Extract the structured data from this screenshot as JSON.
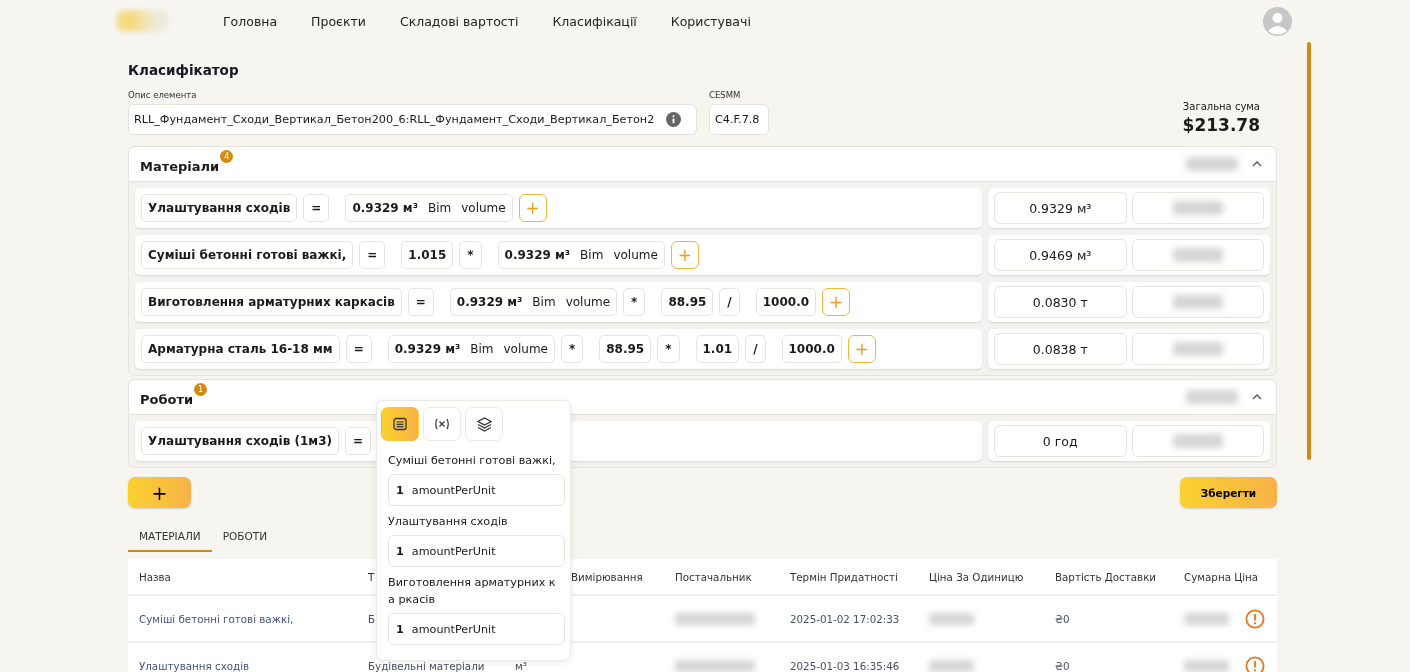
{
  "nav": {
    "items": [
      "Головна",
      "Проєкти",
      "Складові вартості",
      "Класифікації",
      "Користувачі"
    ]
  },
  "title": "Класифікатор",
  "description": {
    "label": "Опис елемента",
    "value": "RLL_Фундамент_Сходи_Вертикал_Бетон200_6:RLL_Фундамент_Сходи_Вертикал_Бетон2"
  },
  "cesmm": {
    "label": "CESMM",
    "value": "C4.F.7.8"
  },
  "total": {
    "label": "Загальна сума",
    "value": "$213.78"
  },
  "sections": [
    {
      "title": "Матеріали",
      "badge": "4",
      "expanded": true,
      "rows": [
        {
          "terms": [
            {
              "kind": "name",
              "text": "Улаштування сходів"
            },
            {
              "kind": "op",
              "text": "="
            },
            {
              "kind": "bim",
              "value": "0.9329 м³",
              "source": "Bim",
              "param": "volume"
            },
            {
              "kind": "add",
              "text": "+"
            }
          ],
          "result": "0.9329 м³"
        },
        {
          "terms": [
            {
              "kind": "name",
              "text": "Суміші бетонні готові важкі,"
            },
            {
              "kind": "op",
              "text": "="
            },
            {
              "kind": "num",
              "text": "1.015"
            },
            {
              "kind": "op",
              "text": "*"
            },
            {
              "kind": "bim",
              "value": "0.9329 м³",
              "source": "Bim",
              "param": "volume"
            },
            {
              "kind": "add",
              "text": "+"
            }
          ],
          "result": "0.9469 м³"
        },
        {
          "terms": [
            {
              "kind": "name",
              "text": "Виготовлення арматурних каркасів"
            },
            {
              "kind": "op",
              "text": "="
            },
            {
              "kind": "bim",
              "value": "0.9329 м³",
              "source": "Bim",
              "param": "volume"
            },
            {
              "kind": "op",
              "text": "*"
            },
            {
              "kind": "num",
              "text": "88.95"
            },
            {
              "kind": "op",
              "text": "/"
            },
            {
              "kind": "num",
              "text": "1000.0"
            },
            {
              "kind": "add",
              "text": "+"
            }
          ],
          "result": "0.0830 т"
        },
        {
          "terms": [
            {
              "kind": "name",
              "text": "Арматурна сталь 16-18 мм"
            },
            {
              "kind": "op",
              "text": "="
            },
            {
              "kind": "bim",
              "value": "0.9329 м³",
              "source": "Bim",
              "param": "volume"
            },
            {
              "kind": "op",
              "text": "*"
            },
            {
              "kind": "num",
              "text": "88.95"
            },
            {
              "kind": "op",
              "text": "*"
            },
            {
              "kind": "num",
              "text": "1.01"
            },
            {
              "kind": "op",
              "text": "/"
            },
            {
              "kind": "num",
              "text": "1000.0"
            },
            {
              "kind": "add",
              "text": "+"
            }
          ],
          "result": "0.0838 т"
        }
      ]
    },
    {
      "title": "Роботи",
      "badge": "1",
      "expanded": true,
      "rows": [
        {
          "terms": [
            {
              "kind": "name",
              "text": "Улаштування сходів (1м3)"
            },
            {
              "kind": "op",
              "text": "="
            }
          ],
          "result": "0 год"
        }
      ]
    }
  ],
  "add_button": "+",
  "save_button": "Зберегти",
  "tabs": [
    {
      "label": "МАТЕРІАЛИ",
      "selected": true
    },
    {
      "label": "РОБОТИ",
      "selected": false
    }
  ],
  "table": {
    "columns": [
      "Назва",
      "Т",
      "Вимірювання",
      "Постачальник",
      "Термін Придатності",
      "Ціна За Одиницю",
      "Вартість Доставки",
      "Сумарна Ціна"
    ],
    "rows": [
      {
        "name": "Суміші бетонні готові важкі,",
        "type": "Б",
        "expiry": "2025-01-02 17:02:33",
        "delivery": "₴0",
        "warning": true
      },
      {
        "name": "Улаштування сходів",
        "type": "Будівельні матеріали",
        "unit": "м³",
        "expiry": "2025-01-03 16:35:46",
        "delivery": "₴0",
        "warning": true
      }
    ]
  },
  "popover": {
    "tools": [
      {
        "kind": "list",
        "selected": true
      },
      {
        "kind": "variable",
        "selected": false
      },
      {
        "kind": "layers",
        "selected": false
      }
    ],
    "entries": [
      {
        "label": "Суміші бетонні готові важкі,",
        "qty": "1",
        "field": "amountPerUnit"
      },
      {
        "label": "Улаштування сходів",
        "qty": "1",
        "field": "amountPerUnit"
      },
      {
        "label": "Виготовлення арматурних ка ркасів",
        "qty": "1",
        "field": "amountPerUnit"
      }
    ]
  }
}
